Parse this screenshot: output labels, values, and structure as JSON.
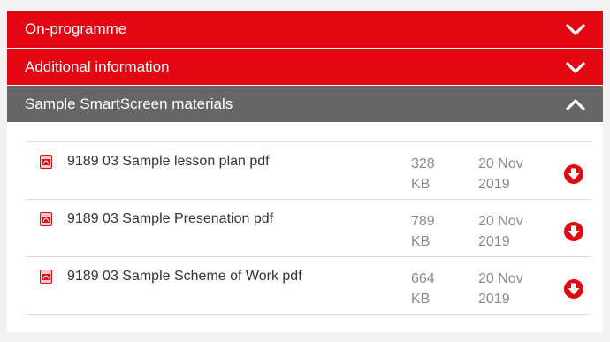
{
  "accordion": {
    "sections": [
      {
        "title": "On-programme",
        "expanded": false,
        "icon": "chevron-down-icon",
        "color": "#e30613"
      },
      {
        "title": "Additional information",
        "expanded": false,
        "icon": "chevron-down-icon",
        "color": "#e30613"
      },
      {
        "title": "Sample SmartScreen materials",
        "expanded": true,
        "icon": "chevron-up-icon",
        "color": "#666666"
      }
    ]
  },
  "files": [
    {
      "name": "9189 03 Sample lesson plan pdf",
      "size_value": "328",
      "size_unit": "KB",
      "date_day_month": "20 Nov",
      "date_year": "2019",
      "icon": "pdf-icon",
      "action_icon": "download-icon"
    },
    {
      "name": "9189 03 Sample Presenation pdf",
      "size_value": "789",
      "size_unit": "KB",
      "date_day_month": "20 Nov",
      "date_year": "2019",
      "icon": "pdf-icon",
      "action_icon": "download-icon"
    },
    {
      "name": "9189 03 Sample Scheme of Work pdf",
      "size_value": "664",
      "size_unit": "KB",
      "date_day_month": "20 Nov",
      "date_year": "2019",
      "icon": "pdf-icon",
      "action_icon": "download-icon"
    }
  ],
  "colors": {
    "accent_red": "#e30613",
    "header_grey": "#666666",
    "text": "#333333",
    "muted": "#8a8a8a"
  }
}
